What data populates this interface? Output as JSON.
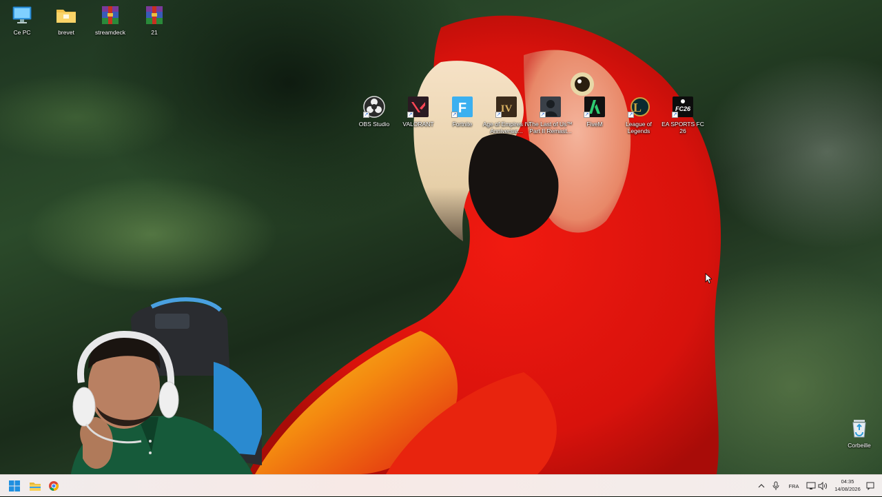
{
  "desktop": {
    "top_icons": [
      {
        "label": "Ce PC",
        "icon": "computer-icon"
      },
      {
        "label": "brevet",
        "icon": "folder-icon"
      },
      {
        "label": "streamdeck",
        "icon": "winrar-archive-icon"
      },
      {
        "label": "21",
        "icon": "winrar-archive-icon"
      }
    ],
    "app_icons": [
      {
        "label": "OBS Studio",
        "icon": "obs-studio-icon"
      },
      {
        "label": "VALORANT",
        "icon": "valorant-icon"
      },
      {
        "label": "Fortnite",
        "icon": "fortnite-icon",
        "glyph": "F"
      },
      {
        "label": "Age of Empires IV Anniversar...",
        "icon": "age-of-empires-icon",
        "glyph": "IV"
      },
      {
        "label": "The Last of Us™ Part II Remast...",
        "icon": "last-of-us-icon"
      },
      {
        "label": "FiveM",
        "icon": "fivem-icon"
      },
      {
        "label": "League of Legends",
        "icon": "league-of-legends-icon",
        "glyph": "L"
      },
      {
        "label": "EA SPORTS FC 26",
        "icon": "ea-sports-fc-icon",
        "glyph": "FC26"
      }
    ],
    "recycle_bin": {
      "label": "Corbeille",
      "icon": "recycle-bin-icon"
    }
  },
  "taskbar": {
    "start": {
      "icon": "windows-start-icon"
    },
    "pinned": [
      {
        "icon": "file-explorer-icon"
      },
      {
        "icon": "chrome-icon"
      }
    ],
    "tray": {
      "chevron": {
        "icon": "chevron-up-icon"
      },
      "mic": {
        "icon": "microphone-icon"
      },
      "language": "FRA",
      "network": {
        "icon": "network-icon"
      },
      "volume": {
        "icon": "volume-icon"
      },
      "time": "04:35",
      "date": "14/08/2026",
      "notifications": {
        "icon": "notification-icon"
      }
    }
  },
  "colors": {
    "parrot_red": "#e0140e",
    "beak": "#eed8b8",
    "taskbar_bg": "#f2ecea",
    "windows_blue": "#1f8fe0"
  }
}
